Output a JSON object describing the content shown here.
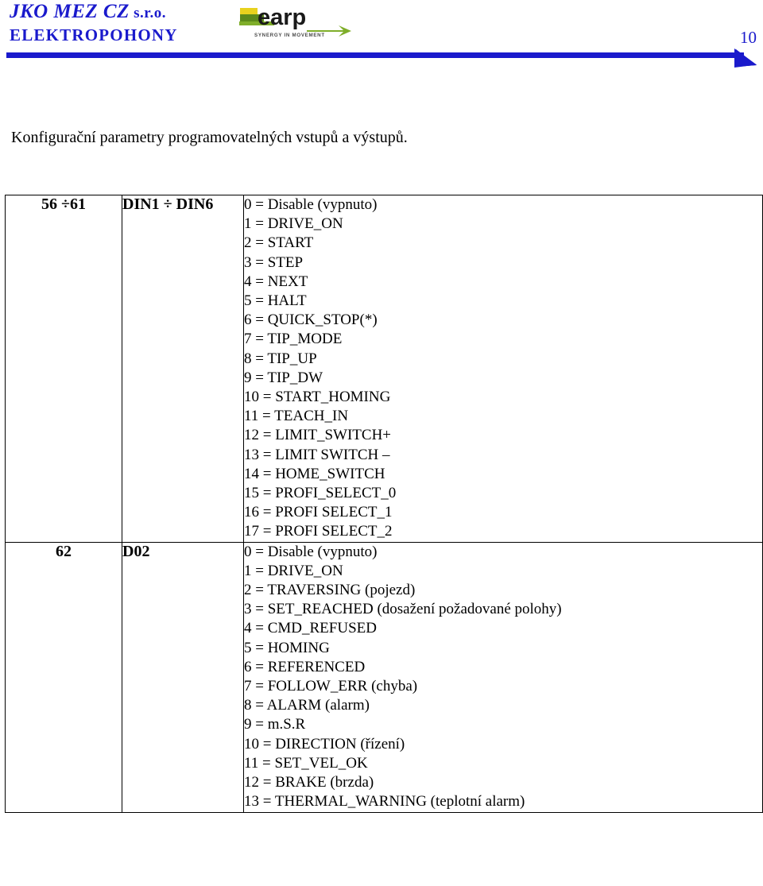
{
  "header": {
    "company_line1": "JKO MEZ CZ",
    "company_line1_suffix": "s.r.o.",
    "company_line2": "ELEKTROPOHONY",
    "logo_word": "earp",
    "logo_tagline": "SYNERGY IN MOVEMENT",
    "page_number": "10",
    "accent_color": "#1a1aCC"
  },
  "title": "Konfigurační parametry programovatelných vstupů a výstupů.",
  "table": {
    "rows": [
      {
        "address": "56 ÷61",
        "name": "DIN1 ÷ DIN6",
        "values": [
          "0 = Disable (vypnuto)",
          "1 = DRIVE_ON",
          "2 = START",
          "3 = STEP",
          "4 = NEXT",
          "5 = HALT",
          "6 = QUICK_STOP(*)",
          "7 = TIP_MODE",
          "8 = TIP_UP",
          "9 = TIP_DW",
          "10 = START_HOMING",
          "11 = TEACH_IN",
          "12 = LIMIT_SWITCH+",
          "13 = LIMIT SWITCH –",
          "14 = HOME_SWITCH",
          "15 = PROFI_SELECT_0",
          "16 = PROFI SELECT_1",
          "17 = PROFI SELECT_2"
        ]
      },
      {
        "address": "62",
        "name": "D02",
        "values": [
          "0 = Disable (vypnuto)",
          "1 = DRIVE_ON",
          "2 = TRAVERSING (pojezd)",
          "3 = SET_REACHED (dosažení požadované polohy)",
          "4 = CMD_REFUSED",
          "5 = HOMING",
          "6 = REFERENCED",
          "7 = FOLLOW_ERR (chyba)",
          "8 = ALARM (alarm)",
          "9 = m.S.R",
          "10 = DIRECTION  (řízení)",
          "11 = SET_VEL_OK",
          "12 = BRAKE  (brzda)",
          "13 = THERMAL_WARNING (teplotní alarm)"
        ]
      }
    ]
  }
}
